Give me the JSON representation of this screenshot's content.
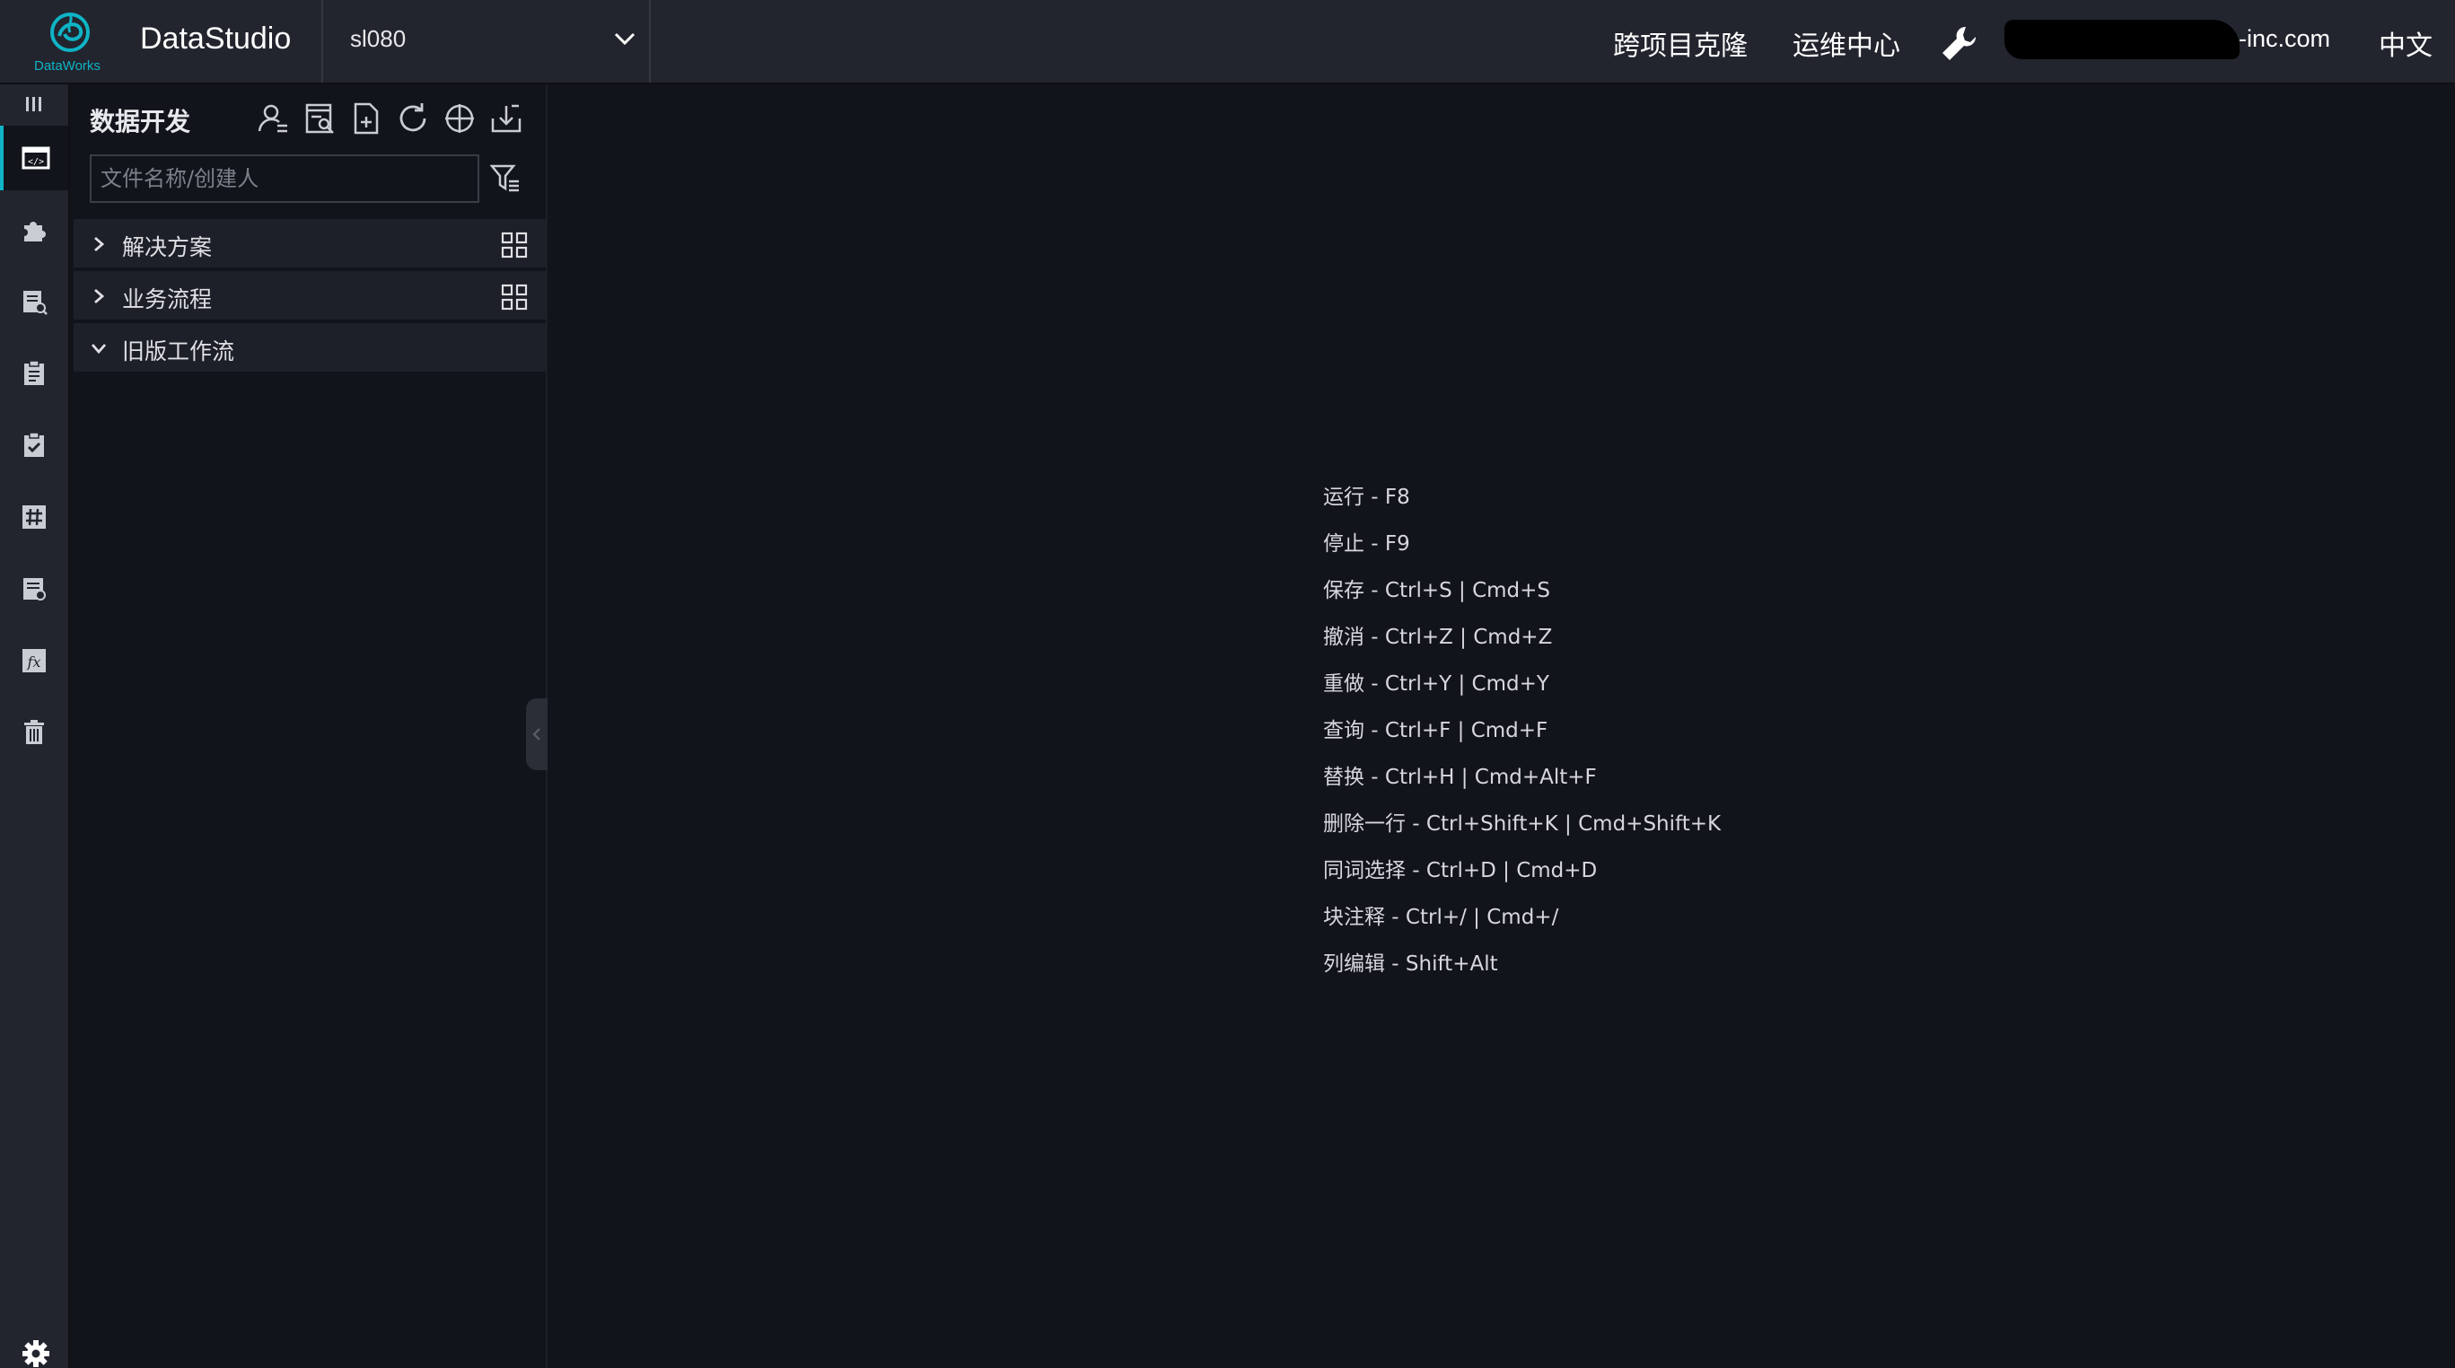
{
  "header": {
    "logo_text": "DataWorks",
    "app_title": "DataStudio",
    "project": "sl080",
    "nav": [
      "跨项目克隆",
      "运维中心"
    ],
    "user_tail": "-inc.com",
    "language": "中文",
    "accent_color": "#0fb4c6"
  },
  "rail": {
    "toggle_icon": "menu-toggle-icon",
    "items": [
      {
        "icon": "data-develop-icon",
        "active": true
      },
      {
        "icon": "component-puzzle-icon",
        "active": false
      },
      {
        "icon": "query-doc-icon",
        "active": false
      },
      {
        "icon": "clipboard-icon",
        "active": false
      },
      {
        "icon": "task-check-icon",
        "active": false
      },
      {
        "icon": "table-hash-icon",
        "active": false
      },
      {
        "icon": "resource-doc-icon",
        "active": false
      },
      {
        "icon": "function-fx-icon",
        "active": false
      },
      {
        "icon": "trash-icon",
        "active": false
      }
    ],
    "settings_icon": "gear-icon"
  },
  "panel": {
    "title": "数据开发",
    "search_placeholder": "文件名称/创建人",
    "tree": [
      {
        "label": "解决方案",
        "expanded": false
      },
      {
        "label": "业务流程",
        "expanded": false
      },
      {
        "label": "旧版工作流",
        "expanded": true
      }
    ]
  },
  "shortcuts": [
    "运行 - F8",
    "停止 - F9",
    "保存 - Ctrl+S | Cmd+S",
    "撤消 - Ctrl+Z | Cmd+Z",
    "重做 - Ctrl+Y | Cmd+Y",
    "查询 - Ctrl+F | Cmd+F",
    "替换 - Ctrl+H | Cmd+Alt+F",
    "删除一行 - Ctrl+Shift+K | Cmd+Shift+K",
    "同词选择 - Ctrl+D | Cmd+D",
    "块注释 - Ctrl+/ | Cmd+/",
    "列编辑 - Shift+Alt"
  ]
}
